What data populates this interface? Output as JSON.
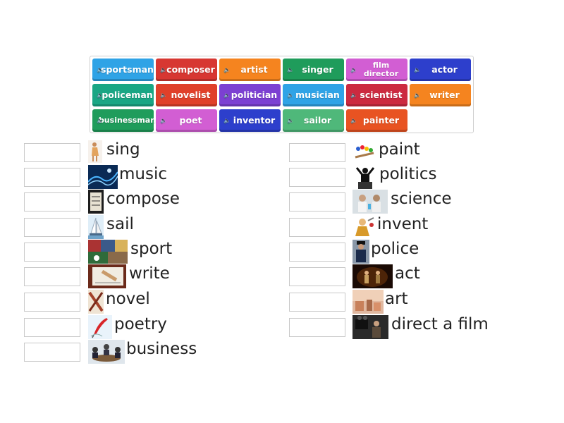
{
  "colors": {
    "blue": "#2fa3e6",
    "red": "#d73732",
    "orange": "#f5841f",
    "green": "#1f9c5b",
    "pink": "#d25ed3",
    "navy": "#2d3fcc",
    "teal": "#1aa684",
    "purple": "#7c40d2",
    "darkred": "#cc2a40",
    "lightgreen": "#4fb87a",
    "orangered": "#e85322"
  },
  "tiles": [
    {
      "label": "sportsman",
      "color": "#2fa3e6",
      "icon": "speaker-icon"
    },
    {
      "label": "composer",
      "color": "#d73732",
      "icon": "speaker-icon"
    },
    {
      "label": "artist",
      "color": "#f5841f",
      "icon": "speaker-icon"
    },
    {
      "label": "singer",
      "color": "#1f9c5b",
      "icon": "speaker-icon"
    },
    {
      "label": "film director",
      "color": "#d25ed3",
      "icon": "speaker-icon"
    },
    {
      "label": "actor",
      "color": "#2d3fcc",
      "icon": "speaker-icon"
    },
    {
      "label": "policeman",
      "color": "#1aa684",
      "icon": "speaker-icon"
    },
    {
      "label": "novelist",
      "color": "#e0402a",
      "icon": "speaker-icon"
    },
    {
      "label": "politician",
      "color": "#7c40d2",
      "icon": "speaker-icon"
    },
    {
      "label": "musician",
      "color": "#2fa3e6",
      "icon": "speaker-icon"
    },
    {
      "label": "scientist",
      "color": "#cc2a40",
      "icon": "speaker-icon"
    },
    {
      "label": "writer",
      "color": "#f5841f",
      "icon": "speaker-icon"
    },
    {
      "label": "businessman",
      "color": "#1f9c5b",
      "icon": "speaker-icon"
    },
    {
      "label": "poet",
      "color": "#d25ed3",
      "icon": "speaker-icon"
    },
    {
      "label": "inventor",
      "color": "#2d3fcc",
      "icon": "speaker-icon"
    },
    {
      "label": "sailor",
      "color": "#4fb87a",
      "icon": "speaker-icon"
    },
    {
      "label": "painter",
      "color": "#e85322",
      "icon": "speaker-icon"
    }
  ],
  "left_items": [
    {
      "word": "sing",
      "image": "singer-image"
    },
    {
      "word": "music",
      "image": "music-image"
    },
    {
      "word": "compose",
      "image": "compose-image"
    },
    {
      "word": "sail",
      "image": "sail-image"
    },
    {
      "word": "sport",
      "image": "sport-image"
    },
    {
      "word": "write",
      "image": "write-image"
    },
    {
      "word": "novel",
      "image": "novel-image"
    },
    {
      "word": "poetry",
      "image": "poetry-image"
    },
    {
      "word": "business",
      "image": "business-image"
    }
  ],
  "right_items": [
    {
      "word": "paint",
      "image": "paint-image"
    },
    {
      "word": "politics",
      "image": "politics-image"
    },
    {
      "word": "science",
      "image": "science-image"
    },
    {
      "word": "invent",
      "image": "invent-image"
    },
    {
      "word": "police",
      "image": "police-image"
    },
    {
      "word": "act",
      "image": "act-image"
    },
    {
      "word": "art",
      "image": "art-image"
    },
    {
      "word": "direct a film",
      "image": "film-image"
    }
  ]
}
